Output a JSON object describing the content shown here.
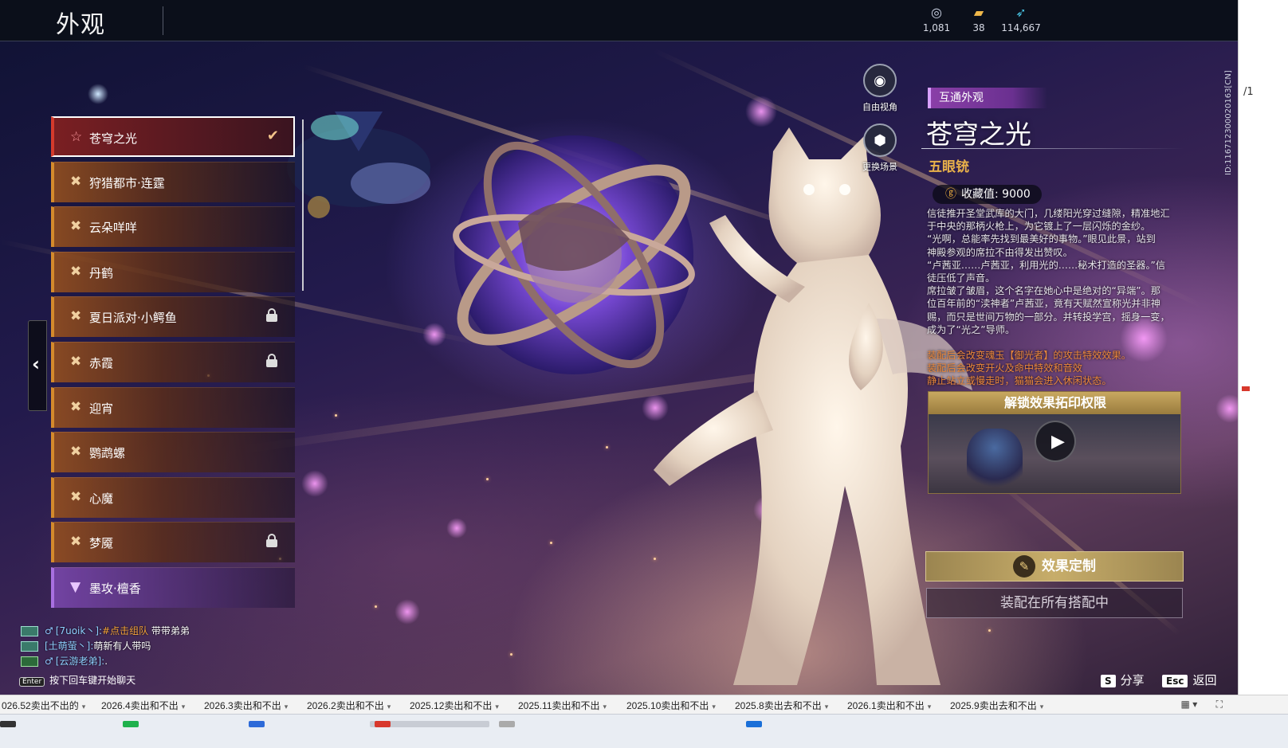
{
  "header": {
    "title": "外观",
    "currencies": [
      {
        "icon": "swirl-coin-icon",
        "value": "1,081"
      },
      {
        "icon": "ticket-icon",
        "value": "38"
      },
      {
        "icon": "feather-icon",
        "value": "114,667"
      }
    ]
  },
  "list": {
    "items": [
      {
        "label": "苍穹之光",
        "selected": true,
        "locked": false
      },
      {
        "label": "狩猎都市·连霆",
        "locked": false
      },
      {
        "label": "云朵咩咩",
        "locked": false
      },
      {
        "label": "丹鹤",
        "locked": false
      },
      {
        "label": "夏日派对·小鳄鱼",
        "locked": true
      },
      {
        "label": "赤霞",
        "locked": true
      },
      {
        "label": "迎宵",
        "locked": false
      },
      {
        "label": "鹦鹉螺",
        "locked": false
      },
      {
        "label": "心魔",
        "locked": false
      },
      {
        "label": "梦魇",
        "locked": true
      },
      {
        "label": "墨攻·檀香",
        "locked": false,
        "rarity": "purple"
      }
    ]
  },
  "camera": {
    "free_view": "自由视角",
    "change_scene": "更换场景"
  },
  "detail": {
    "type_badge": "互通外观",
    "name": "苍穹之光",
    "subtitle": "五眼铳",
    "collect_label": "收藏值: 9000",
    "description": [
      "信徒推开圣堂武库的大门，几缕阳光穿过缝隙，精准地汇",
      "于中央的那柄火枪上，为它镀上了一层闪烁的金纱。",
      "“光啊，总能率先找到最美好的事物。”眼见此景，站到",
      "神殿参观的席拉不由得发出赞叹。",
      "“卢茜亚……卢茜亚，利用光的……秘术打造的圣器。”信",
      "徒压低了声音。",
      "席拉皱了皱眉，这个名字在她心中是绝对的“异端”。那",
      "位百年前的“渎神者”卢茜亚，竟有天赋然宣称光并非神",
      "赐，而只是世间万物的一部分。并转投学宫，摇身一变，",
      "成为了“光之”导师。"
    ],
    "effects": [
      "装配后会改变魂玉【御光者】的攻击特效效果。",
      "装配后会改变开火及命中特效和音效",
      "静止站立或慢走时，猫猫会进入休闲状态。"
    ],
    "unlock_title": "解锁效果拓印权限",
    "custom_button": "效果定制",
    "equip_button": "装配在所有搭配中",
    "side_id": "ID:116712300020163[CN]"
  },
  "chat": {
    "lines": [
      {
        "name": "[7uoik丶]:",
        "highlight": "#点击组队",
        "text": " 带带弟弟"
      },
      {
        "name": "[土萌萤丶]:",
        "highlight": "",
        "text": "萌新有人带吗"
      },
      {
        "name": "[云游老弟]:",
        "highlight": "",
        "text": "."
      }
    ],
    "enter_key": "Enter",
    "hint": "按下回车键开始聊天"
  },
  "keys": {
    "share_key": "S",
    "share_label": "分享",
    "back_key": "Esc",
    "back_label": "返回"
  },
  "window": {
    "page_fraction": "/1"
  },
  "bookmarks": [
    "026.52卖出不出的",
    "2026.4卖出和不出",
    "2026.3卖出和不出",
    "2026.2卖出和不出",
    "2025.12卖出和不出",
    "2025.11卖出和不出",
    "2025.10卖出和不出",
    "2025.8卖出去和不出",
    "2026.1卖出和不出",
    "2025.9卖出去和不出"
  ],
  "colors": {
    "accent_gold": "#e8b04a",
    "effect_orange": "#e9863a",
    "badge_purple": "#8a3fa8",
    "selected_red": "#d43a2c"
  }
}
